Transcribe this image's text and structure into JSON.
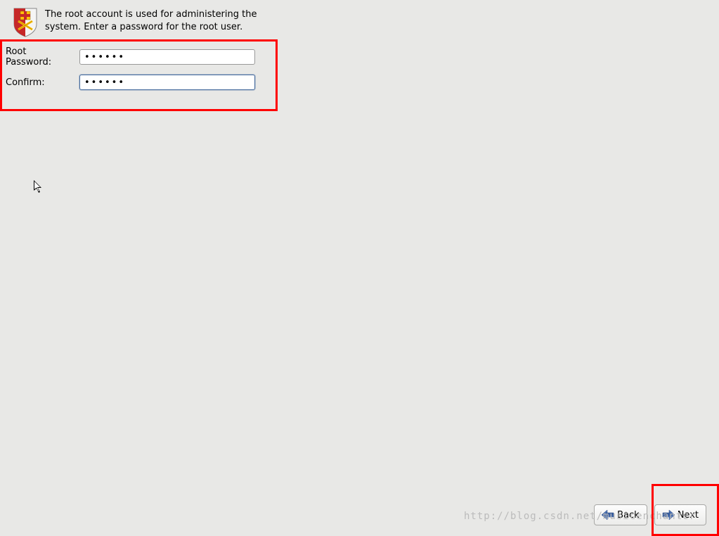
{
  "header": {
    "description": "The root account is used for administering the system.  Enter a password for the root user."
  },
  "form": {
    "root_password": {
      "label": "Root Password:",
      "value": "••••••"
    },
    "confirm": {
      "label": "Confirm:",
      "value": "••••••"
    }
  },
  "buttons": {
    "back": "Back",
    "next": "Next"
  },
  "watermark": "http://blog.csdn.net/musicenchanter"
}
